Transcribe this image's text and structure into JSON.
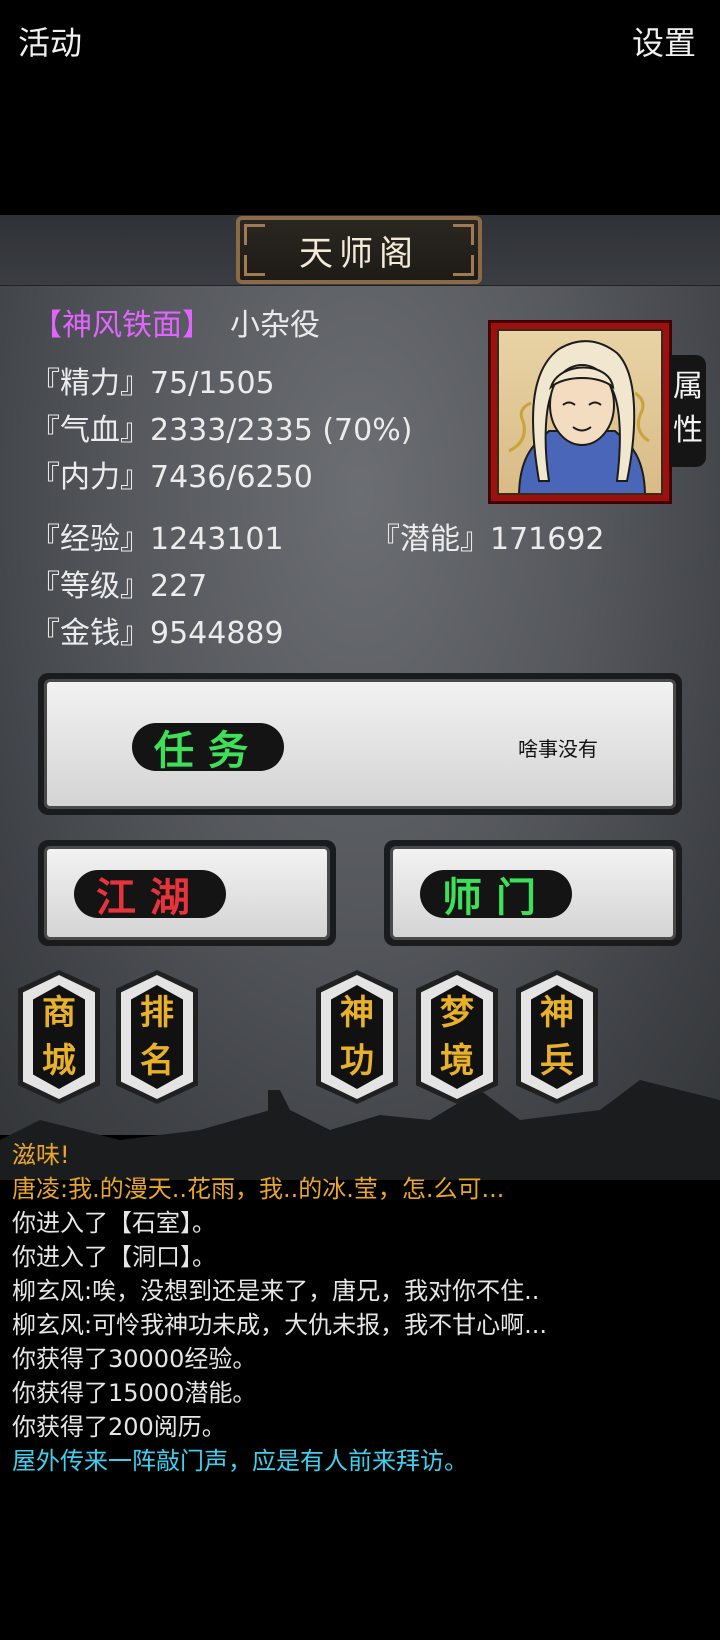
{
  "header": {
    "left_button": "活动",
    "title": "天师阁",
    "right_button": "设置"
  },
  "character": {
    "title": "【神风铁面】",
    "rank": "小杂役",
    "stats": {
      "jingli": "『精力』75/1505",
      "qixue": "『气血』2333/2335 (70%)",
      "neili": "『内力』7436/6250",
      "jingyan": "『经验』1243101",
      "qianneng": "『潜能』171692",
      "dengji": "『等级』227",
      "jinqian": "『金钱』9544889"
    },
    "attr_tab": [
      "属",
      "性"
    ]
  },
  "task_card": {
    "label": "任务",
    "note": "啥事没有"
  },
  "jianghu_card": {
    "label": "江湖"
  },
  "shimen_card": {
    "label": "师门"
  },
  "menu": [
    {
      "chars": [
        "商",
        "城"
      ]
    },
    {
      "chars": [
        "排",
        "名"
      ]
    },
    {
      "chars": [
        "神",
        "功"
      ]
    },
    {
      "chars": [
        "梦",
        "境"
      ]
    },
    {
      "chars": [
        "神",
        "兵"
      ]
    }
  ],
  "log": [
    {
      "text": "滋味!",
      "color": "#e8a72a"
    },
    {
      "text": "唐凌:我.的漫天..花雨，我..的冰.莹，怎.么可...",
      "color": "#e8a72a"
    },
    {
      "text": "你进入了【石室】。",
      "color": "#e6e6e6"
    },
    {
      "text": "你进入了【洞口】。",
      "color": "#e6e6e6"
    },
    {
      "text": "柳玄风:唉，没想到还是来了，唐兄，我对你不住..",
      "color": "#e6e6e6"
    },
    {
      "text": "柳玄风:可怜我神功未成，大仇未报，我不甘心啊...",
      "color": "#e6e6e6"
    },
    {
      "text": "你获得了30000经验。",
      "color": "#e6e6e6"
    },
    {
      "text": "你获得了15000潜能。",
      "color": "#e6e6e6"
    },
    {
      "text": "你获得了200阅历。",
      "color": "#e6e6e6"
    },
    {
      "text": "屋外传来一阵敲门声，应是有人前来拜访。",
      "color": "#3fd0ef"
    }
  ],
  "colors": {
    "task_label": "#3ee05a",
    "jianghu_label": "#e8333a",
    "shimen_label": "#3ee05a",
    "title_purple": "#e264ff"
  }
}
